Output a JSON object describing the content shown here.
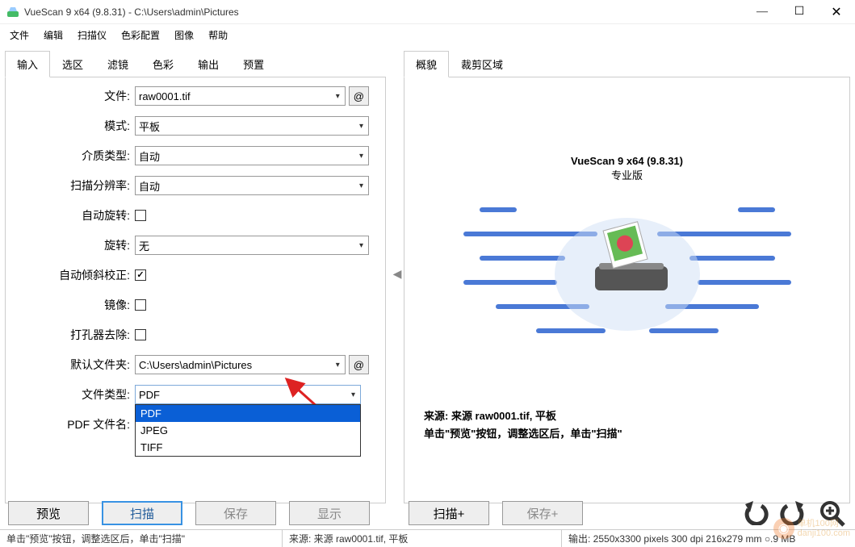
{
  "window": {
    "title": "VueScan 9 x64 (9.8.31) - C:\\Users\\admin\\Pictures"
  },
  "menu": {
    "items": [
      "文件",
      "编辑",
      "扫描仪",
      "色彩配置",
      "图像",
      "帮助"
    ]
  },
  "left_tabs": [
    "输入",
    "选区",
    "滤镜",
    "色彩",
    "输出",
    "预置"
  ],
  "right_tabs": [
    "概貌",
    "裁剪区域"
  ],
  "form": {
    "file_label": "文件:",
    "file_value": "raw0001.tif",
    "mode_label": "模式:",
    "mode_value": "平板",
    "media_label": "介质类型:",
    "media_value": "自动",
    "res_label": "扫描分辨率:",
    "res_value": "自动",
    "autorotate_label": "自动旋转:",
    "rotate_label": "旋转:",
    "rotate_value": "无",
    "deskew_label": "自动倾斜校正:",
    "mirror_label": "镜像:",
    "punch_label": "打孔器去除:",
    "folder_label": "默认文件夹:",
    "folder_value": "C:\\Users\\admin\\Pictures",
    "filetype_label": "文件类型:",
    "filetype_value": "PDF",
    "filetype_options": [
      "PDF",
      "JPEG",
      "TIFF"
    ],
    "filename_label": "PDF 文件名:",
    "at": "@"
  },
  "preview": {
    "title": "VueScan 9 x64 (9.8.31)",
    "subtitle": "专业版",
    "source_line": "来源: 来源 raw0001.tif, 平板",
    "hint_line": "单击\"预览\"按钮，调整选区后，单击\"扫描\""
  },
  "buttons": {
    "preview": "预览",
    "scan": "扫描",
    "save": "保存",
    "display": "显示",
    "scan_plus": "扫描+",
    "save_plus": "保存+"
  },
  "status": {
    "left": "单击\"预览\"按钮，调整选区后，单击\"扫描\"",
    "mid": "来源: 来源 raw0001.tif, 平板",
    "right": "输出: 2550x3300 pixels 300 dpi 216x279 mm ○.9 MB"
  },
  "watermark": "单机100网\ndanji100.com"
}
